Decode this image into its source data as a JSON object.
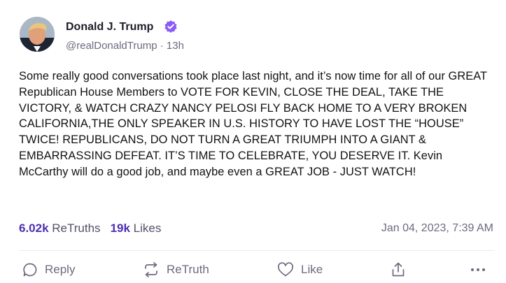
{
  "author": {
    "name": "Donald J. Trump",
    "handle_time": "@realDonaldTrump · 13h",
    "verified": true,
    "verified_color": "#8a5cf6"
  },
  "post": {
    "text": "Some really good conversations took place last night, and it’s now time for all of our GREAT Republican House Members to VOTE FOR KEVIN, CLOSE THE DEAL, TAKE THE VICTORY, & WATCH CRAZY NANCY PELOSI FLY BACK HOME TO A VERY BROKEN CALIFORNIA,THE ONLY SPEAKER IN U.S. HISTORY TO HAVE LOST THE “HOUSE” TWICE! REPUBLICANS, DO NOT TURN A GREAT TRIUMPH INTO A GIANT & EMBARRASSING DEFEAT. IT’S TIME TO CELEBRATE, YOU DESERVE IT. Kevin McCarthy will do a good job, and maybe even a GREAT JOB - JUST WATCH!"
  },
  "stats": {
    "retruths_count": "6.02k",
    "retruths_label": "ReTruths",
    "likes_count": "19k",
    "likes_label": "Likes",
    "timestamp": "Jan 04, 2023, 7:39 AM"
  },
  "actions": {
    "reply": "Reply",
    "retruth": "ReTruth",
    "like": "Like"
  },
  "icons": [
    "reply-icon",
    "retruth-icon",
    "like-icon",
    "share-icon",
    "more-icon",
    "verified-badge-icon"
  ],
  "colors": {
    "accent": "#4d2fb0",
    "muted": "#6b6b80"
  }
}
